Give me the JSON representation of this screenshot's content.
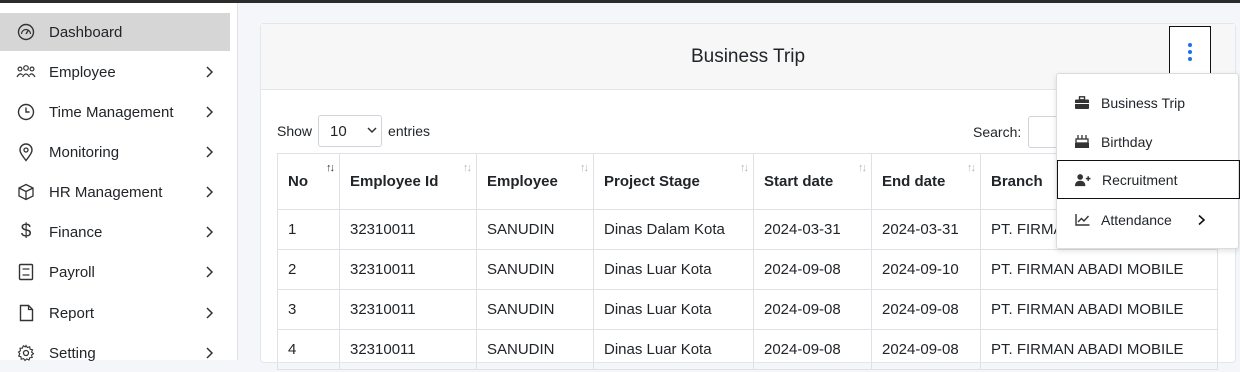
{
  "sidebar": {
    "items": [
      {
        "label": "Dashboard",
        "icon": "dashboard-gauge-icon",
        "active": true,
        "has_submenu": false
      },
      {
        "label": "Employee",
        "icon": "people-icon",
        "active": false,
        "has_submenu": true
      },
      {
        "label": "Time Management",
        "icon": "clock-icon",
        "active": false,
        "has_submenu": true
      },
      {
        "label": "Monitoring",
        "icon": "map-pin-icon",
        "active": false,
        "has_submenu": true
      },
      {
        "label": "HR Management",
        "icon": "cube-icon",
        "active": false,
        "has_submenu": true
      },
      {
        "label": "Finance",
        "icon": "dollar-icon",
        "active": false,
        "has_submenu": true
      },
      {
        "label": "Payroll",
        "icon": "receipt-icon",
        "active": false,
        "has_submenu": true
      },
      {
        "label": "Report",
        "icon": "file-icon",
        "active": false,
        "has_submenu": true
      },
      {
        "label": "Setting",
        "icon": "gear-icon",
        "active": false,
        "has_submenu": true
      }
    ]
  },
  "card": {
    "title": "Business Trip",
    "show_label": "Show",
    "entries_value": "10",
    "entries_label": "entries",
    "search_label": "Search:"
  },
  "table": {
    "columns": [
      "No",
      "Employee Id",
      "Employee",
      "Project Stage",
      "Start date",
      "End date",
      "Branch"
    ],
    "rows": [
      [
        "1",
        "32310011",
        "SANUDIN",
        "Dinas Dalam Kota",
        "2024-03-31",
        "2024-03-31",
        "PT. FIRMA"
      ],
      [
        "2",
        "32310011",
        "SANUDIN",
        "Dinas Luar Kota",
        "2024-09-08",
        "2024-09-10",
        "PT. FIRMAN ABADI MOBILE"
      ],
      [
        "3",
        "32310011",
        "SANUDIN",
        "Dinas Luar Kota",
        "2024-09-08",
        "2024-09-08",
        "PT. FIRMAN ABADI MOBILE"
      ],
      [
        "4",
        "32310011",
        "SANUDIN",
        "Dinas Luar Kota",
        "2024-09-08",
        "2024-09-08",
        "PT. FIRMAN ABADI MOBILE"
      ]
    ]
  },
  "dropdown": {
    "items": [
      {
        "label": "Business Trip",
        "icon": "briefcase-icon"
      },
      {
        "label": "Birthday",
        "icon": "cake-icon"
      },
      {
        "label": "Recruitment",
        "icon": "user-plus-icon"
      },
      {
        "label": "Attendance",
        "icon": "chart-line-icon"
      }
    ]
  },
  "colors": {
    "accent": "#1a73e8",
    "active_bg": "#d6d6d6"
  }
}
